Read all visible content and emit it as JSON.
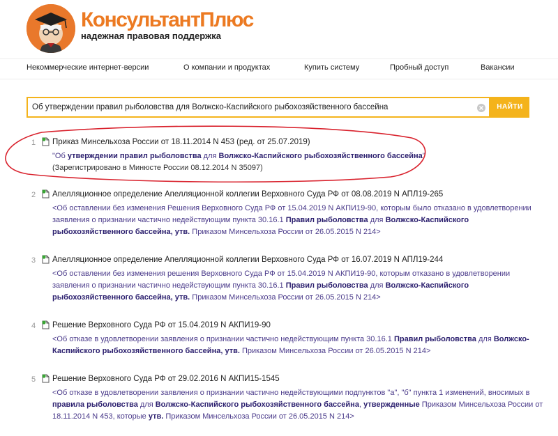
{
  "header": {
    "brand": "КонсультантПлюс",
    "tagline": "надежная правовая поддержка"
  },
  "nav": {
    "items": [
      "Некоммерческие интернет-версии",
      "О компании и продуктах",
      "Купить систему",
      "Пробный доступ",
      "Вакансии"
    ]
  },
  "search": {
    "value": "Об утверждении правил рыболовства для Волжско-Каспийского рыбохозяйственного бассейна",
    "button_label": "НАЙТИ"
  },
  "results": [
    {
      "num": "1",
      "title": "Приказ Минсельхоза России от 18.11.2014 N 453 (ред. от 25.07.2019)",
      "desc": [
        {
          "t": "\"Об ",
          "b": false
        },
        {
          "t": "утверждении правил рыболовства",
          "b": true
        },
        {
          "t": " для ",
          "b": false
        },
        {
          "t": "Волжско-Каспийского рыбохозяйственного бассейна",
          "b": true
        },
        {
          "t": "\"",
          "b": false
        }
      ],
      "reg": "(Зарегистрировано в Минюсте России 08.12.2014 N 35097)"
    },
    {
      "num": "2",
      "title": "Апелляционное определение Апелляционной коллегии Верховного Суда РФ от 08.08.2019 N АПЛ19-265",
      "desc": [
        {
          "t": "<Об оставлении без изменения Решения Верховного Суда РФ от 15.04.2019 N АКПИ19-90, которым было отказано в удовлетворении заявления о признании частично недействующим пункта 30.16.1 ",
          "b": false
        },
        {
          "t": "Правил рыболовства",
          "b": true
        },
        {
          "t": " для ",
          "b": false
        },
        {
          "t": "Волжско-Каспийского рыбохозяйственного бассейна, утв.",
          "b": true
        },
        {
          "t": " Приказом Минсельхоза России от 26.05.2015 N 214>",
          "b": false
        }
      ],
      "reg": ""
    },
    {
      "num": "3",
      "title": "Апелляционное определение Апелляционной коллегии Верховного Суда РФ от 16.07.2019 N АПЛ19-244",
      "desc": [
        {
          "t": "<Об оставлении без изменения решения Верховного Суда РФ от 15.04.2019 N АКПИ19-90, которым отказано в удовлетворении заявления о признании частично недействующим пункта 30.16.1 ",
          "b": false
        },
        {
          "t": "Правил рыболовства",
          "b": true
        },
        {
          "t": " для ",
          "b": false
        },
        {
          "t": "Волжско-Каспийского рыбохозяйственного бассейна, утв.",
          "b": true
        },
        {
          "t": " Приказом Минсельхоза России от 26.05.2015 N 214>",
          "b": false
        }
      ],
      "reg": ""
    },
    {
      "num": "4",
      "title": "Решение Верховного Суда РФ от 15.04.2019 N АКПИ19-90",
      "desc": [
        {
          "t": "<Об отказе в удовлетворении заявления о признании частично недействующим пункта 30.16.1 ",
          "b": false
        },
        {
          "t": "Правил рыболовства",
          "b": true
        },
        {
          "t": " для ",
          "b": false
        },
        {
          "t": "Волжско-Каспийского рыбохозяйственного бассейна, утв.",
          "b": true
        },
        {
          "t": " Приказом Минсельхоза России от 26.05.2015 N 214>",
          "b": false
        }
      ],
      "reg": ""
    },
    {
      "num": "5",
      "title": "Решение Верховного Суда РФ от 29.02.2016 N АКПИ15-1545",
      "desc": [
        {
          "t": "<Об отказе в удовлетворении заявления о признании частично недействующими подпунктов \"а\", \"б\" пункта 1 изменений, вносимых в ",
          "b": false
        },
        {
          "t": "правила рыболовства",
          "b": true
        },
        {
          "t": " для ",
          "b": false
        },
        {
          "t": "Волжско-Каспийского рыбохозяйственного бассейна",
          "b": true
        },
        {
          "t": ", ",
          "b": false
        },
        {
          "t": "утвержденные",
          "b": true
        },
        {
          "t": " Приказом Минсельхоза России от 18.11.2014 N 453, которые ",
          "b": false
        },
        {
          "t": "утв.",
          "b": true
        },
        {
          "t": " Приказом Минсельхоза России от 26.05.2015 N 214>",
          "b": false
        }
      ],
      "reg": ""
    }
  ],
  "colors": {
    "brand_orange": "#ec7a22",
    "search_yellow": "#f4b31b",
    "link_purple": "#4a3a8a",
    "annotation_red": "#d9232e"
  }
}
